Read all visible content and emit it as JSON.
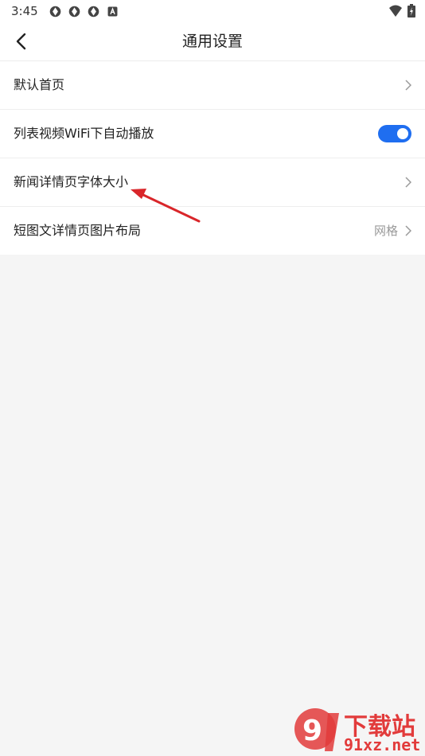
{
  "status_bar": {
    "time": "3:45"
  },
  "header": {
    "title": "通用设置"
  },
  "settings": [
    {
      "label": "默认首页"
    },
    {
      "label": "列表视频WiFi下自动播放",
      "toggle_on": true
    },
    {
      "label": "新闻详情页字体大小"
    },
    {
      "label": "短图文详情页图片布局",
      "value": "网格"
    }
  ],
  "watermark": {
    "text_main": "下载站",
    "text_sub": "91xz.net"
  },
  "colors": {
    "accent": "#1f6ef0",
    "annotation_arrow": "#d9262a",
    "background": "#f5f5f5"
  }
}
